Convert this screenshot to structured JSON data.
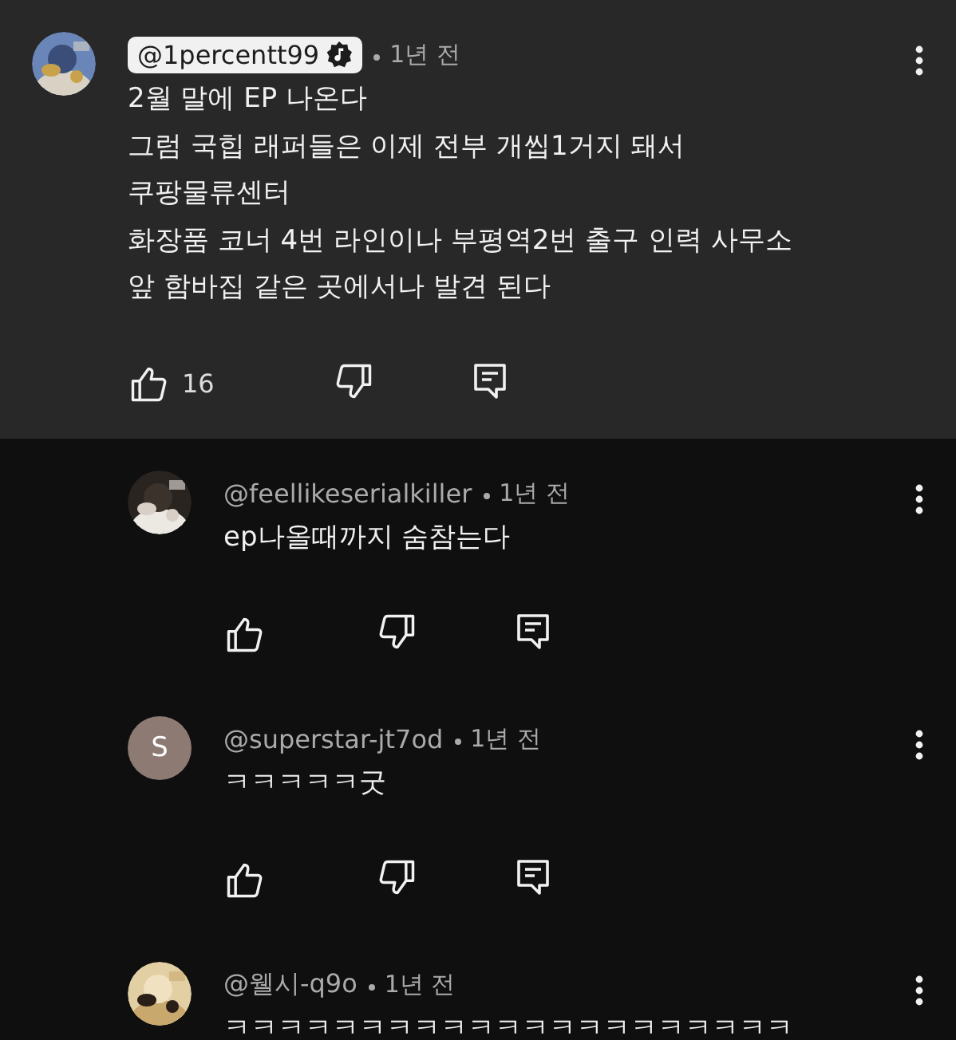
{
  "comments": [
    {
      "kind": "highlighted",
      "author": "@1percentt99",
      "verified": true,
      "time": "1년 전",
      "lines": [
        "2월 말에 EP 나온다",
        "그럼 국힙 래퍼들은 이제 전부 개씹1거지 돼서",
        "쿠팡물류센터",
        "화장품 코너 4번 라인이나 부평역2번 출구 인력 사무소",
        "앞 함바집 같은 곳에서나 발견 된다"
      ],
      "likes": "16"
    },
    {
      "kind": "reply",
      "author": "@feellikeserialkiller",
      "verified": false,
      "time": "1년 전",
      "lines": [
        "ep나올때까지 숨참는다"
      ]
    },
    {
      "kind": "reply",
      "avatar": {
        "kind": "letter",
        "letter": "S",
        "color": "#8d7a73"
      },
      "author": "@superstar-jt7od",
      "verified": false,
      "time": "1년 전",
      "lines": [
        "ㅋㅋㅋㅋㅋ굿"
      ]
    },
    {
      "kind": "reply",
      "author": "@웰시-q9o",
      "verified": false,
      "time": "1년 전",
      "lines": [
        "ㅋㅋㅋㅋㅋㅋㅋㅋㅋㅋㅋㅋㅋㅋㅋㅋㅋㅋㅋㅋㅋ"
      ]
    }
  ]
}
